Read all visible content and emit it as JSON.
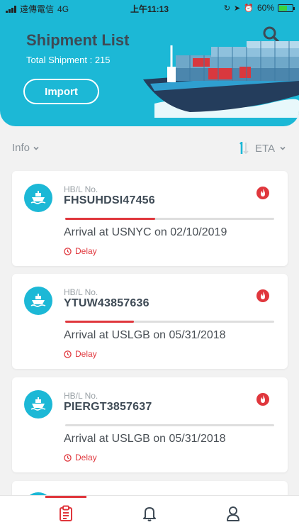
{
  "status_bar": {
    "carrier": "遠傳電信",
    "network": "4G",
    "time": "上午11:13",
    "battery": "60%",
    "battery_level": 0.6
  },
  "header": {
    "title": "Shipment List",
    "subtitle": "Total Shipment : 215",
    "import_label": "Import"
  },
  "filters": {
    "info_label": "Info",
    "sort_label": "ETA"
  },
  "shipments": [
    {
      "label": "HB/L No.",
      "number": "FHSUHDSI47456",
      "arrival": "Arrival at USNYC on 02/10/2019",
      "status": "Delay",
      "progress": 0.43
    },
    {
      "label": "HB/L No.",
      "number": "YTUW43857636",
      "arrival": "Arrival at USLGB on 05/31/2018",
      "status": "Delay",
      "progress": 0.33
    },
    {
      "label": "HB/L No.",
      "number": "PIERGT3857637",
      "arrival": "Arrival at USLGB on 05/31/2018",
      "status": "Delay",
      "progress": 0.0
    }
  ],
  "colors": {
    "accent": "#1cb8d6",
    "alert": "#e0373d",
    "title": "#3e4a55"
  },
  "tabs": [
    {
      "icon": "clipboard-icon",
      "active": true
    },
    {
      "icon": "bell-icon",
      "active": false
    },
    {
      "icon": "user-icon",
      "active": false
    }
  ]
}
